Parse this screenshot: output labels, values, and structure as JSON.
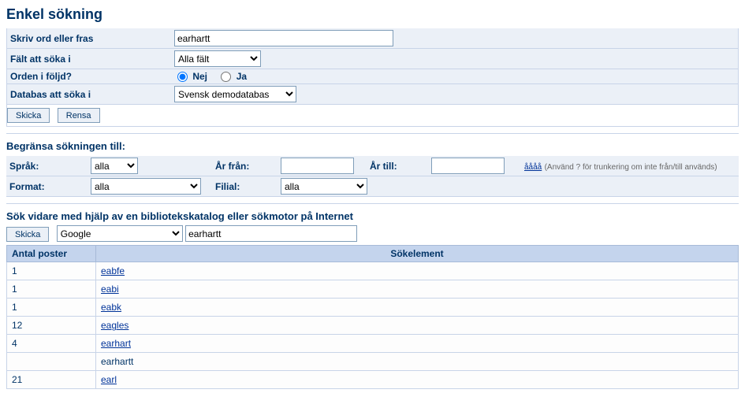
{
  "title": "Enkel sökning",
  "form": {
    "query_label": "Skriv ord eller fras",
    "query_value": "earhartt",
    "field_label": "Fält att söka i",
    "field_value": "Alla fält",
    "order_label": "Orden i följd?",
    "order_no_label": "Nej",
    "order_yes_label": "Ja",
    "database_label": "Databas att söka i",
    "database_value": "Svensk demodatabas",
    "submit_label": "Skicka",
    "clear_label": "Rensa"
  },
  "limit": {
    "heading": "Begränsa sökningen till:",
    "language_label": "Språk:",
    "language_value": "alla",
    "year_from_label": "År från:",
    "year_from_value": "",
    "year_to_label": "År till:",
    "year_to_value": "",
    "year_hint_link": "åååå",
    "year_hint_text": "(Använd ? för trunkering om inte från/till används)",
    "format_label": "Format:",
    "format_value": "alla",
    "branch_label": "Filial:",
    "branch_value": "alla"
  },
  "external": {
    "heading": "Sök vidare med hjälp av en bibliotekskatalog eller sökmotor på Internet",
    "submit_label": "Skicka",
    "engine_value": "Google",
    "query_value": "earhartt"
  },
  "results": {
    "count_header": "Antal poster",
    "term_header": "Sökelement",
    "rows": [
      {
        "count": "1",
        "term": "eabfe",
        "link": true
      },
      {
        "count": "1",
        "term": "eabi",
        "link": true
      },
      {
        "count": "1",
        "term": "eabk",
        "link": true
      },
      {
        "count": "12",
        "term": "eagles",
        "link": true
      },
      {
        "count": "4",
        "term": "earhart",
        "link": true
      },
      {
        "count": "",
        "term": "earhartt",
        "link": false
      },
      {
        "count": "21",
        "term": "earl",
        "link": true
      }
    ]
  }
}
